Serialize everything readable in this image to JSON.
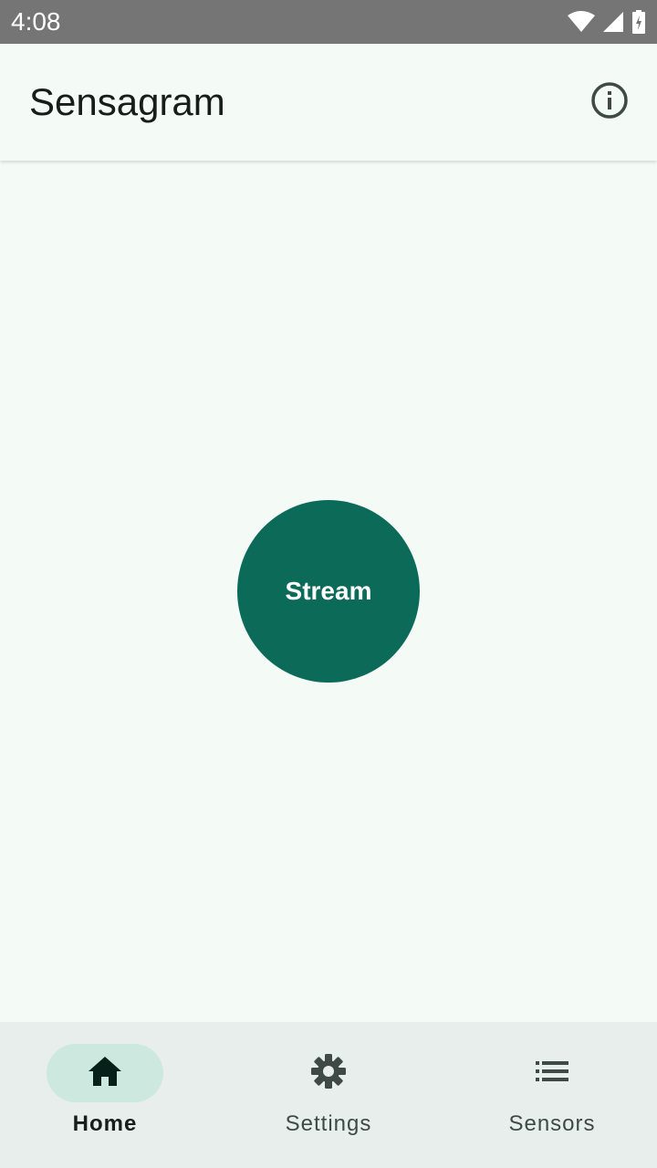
{
  "status_bar": {
    "time": "4:08",
    "icons": [
      "wifi-icon",
      "cellular-signal-icon",
      "battery-charging-icon"
    ]
  },
  "app_bar": {
    "title": "Sensagram",
    "action_icon": "info-icon"
  },
  "main": {
    "stream_button_label": "Stream"
  },
  "bottom_nav": {
    "items": [
      {
        "label": "Home",
        "icon": "home-icon",
        "active": true
      },
      {
        "label": "Settings",
        "icon": "gear-icon",
        "active": false
      },
      {
        "label": "Sensors",
        "icon": "list-icon",
        "active": false
      }
    ]
  },
  "colors": {
    "background": "#F4FAF6",
    "status_bar": "#757575",
    "primary": "#0C6B58",
    "nav_background": "#E8EEEB",
    "nav_active_indicator": "#CDE8DF"
  }
}
